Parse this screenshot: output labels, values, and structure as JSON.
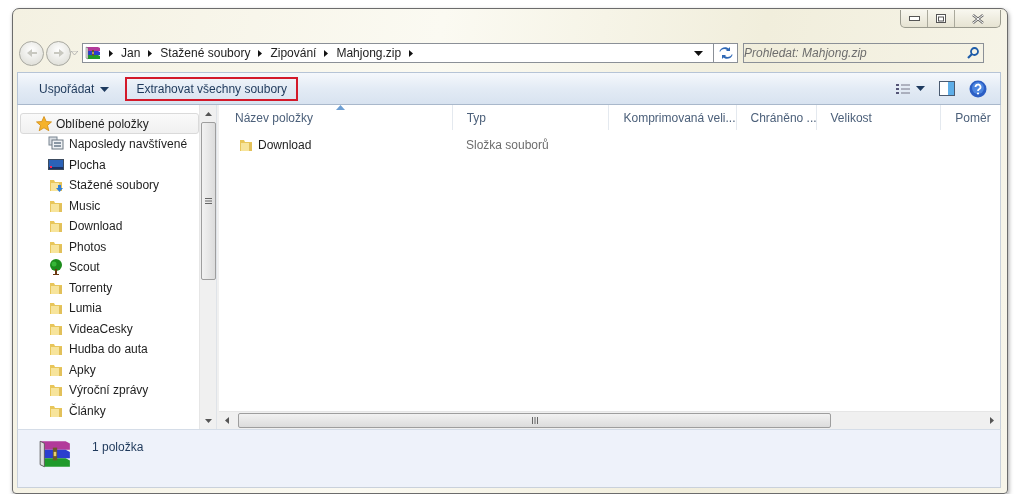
{
  "address": {
    "segments": [
      "Jan",
      "Stažené soubory",
      "Zipování",
      "Mahjong.zip"
    ]
  },
  "search": {
    "placeholder": "Prohledat: Mahjong.zip"
  },
  "toolbar": {
    "buttons": [
      {
        "label": "Uspořádat",
        "has_menu": true,
        "highlighted": false
      },
      {
        "label": "Extrahovat všechny soubory",
        "has_menu": false,
        "highlighted": true
      }
    ]
  },
  "sidebar": {
    "header": "Oblíbené položky",
    "items": [
      {
        "label": "Naposledy navštívené",
        "kind": "recent"
      },
      {
        "label": "Plocha",
        "kind": "desktop"
      },
      {
        "label": "Stažené soubory",
        "kind": "downloads"
      },
      {
        "label": "Music",
        "kind": "folder"
      },
      {
        "label": "Download",
        "kind": "folder"
      },
      {
        "label": "Photos",
        "kind": "folder"
      },
      {
        "label": "Scout",
        "kind": "tree"
      },
      {
        "label": "Torrenty",
        "kind": "folder"
      },
      {
        "label": "Lumia",
        "kind": "folder"
      },
      {
        "label": "VideaCesky",
        "kind": "folder"
      },
      {
        "label": "Hudba do auta",
        "kind": "folder"
      },
      {
        "label": "Apky",
        "kind": "folder"
      },
      {
        "label": "Výroční zprávy",
        "kind": "folder"
      },
      {
        "label": "Články",
        "kind": "folder"
      }
    ]
  },
  "table": {
    "columns": [
      {
        "label": "Název položky",
        "sorted": true
      },
      {
        "label": "Typ",
        "sorted": false
      },
      {
        "label": "Komprimovaná veli...",
        "sorted": false
      },
      {
        "label": "Chráněno ...",
        "sorted": false
      },
      {
        "label": "Velikost",
        "sorted": false
      },
      {
        "label": "Poměr",
        "sorted": false
      }
    ],
    "rows": [
      {
        "name": "Download",
        "type": "Složka souborů",
        "kind": "folder"
      }
    ]
  },
  "status_bar": {
    "text": "1 položka"
  }
}
